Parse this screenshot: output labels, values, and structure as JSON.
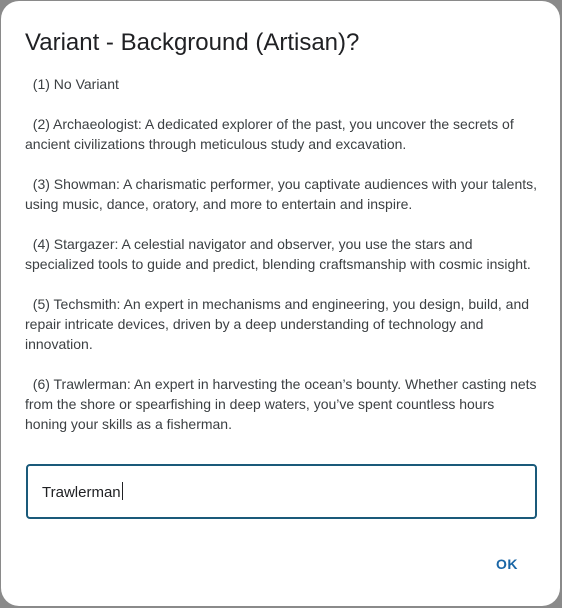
{
  "dialog": {
    "title": "Variant - Background (Artisan)?",
    "options": [
      "(1) No Variant",
      "(2) Archaeologist: A dedicated explorer of the past, you uncover the secrets of ancient civilizations through meticulous study and excavation.",
      "(3) Showman: A charismatic performer, you captivate audiences with your talents, using music, dance, oratory, and more to entertain and inspire.",
      "(4) Stargazer: A celestial navigator and observer, you use the stars and specialized tools to guide and predict, blending craftsmanship with cosmic insight.",
      "(5) Techsmith: An expert in mechanisms and engineering, you design, build, and repair intricate devices, driven by a deep understanding of technology and innovation.",
      "(6) Trawlerman: An expert in harvesting the ocean’s bounty. Whether casting nets from the shore or spearfishing in deep waters, you’ve spent countless hours honing your skills as a fisherman."
    ],
    "input": {
      "value": "Trawlerman"
    },
    "ok_label": "OK"
  },
  "colors": {
    "accent": "#1a66a6",
    "input_border": "#1a5a7a",
    "text": "#3c4043",
    "title": "#202124"
  }
}
